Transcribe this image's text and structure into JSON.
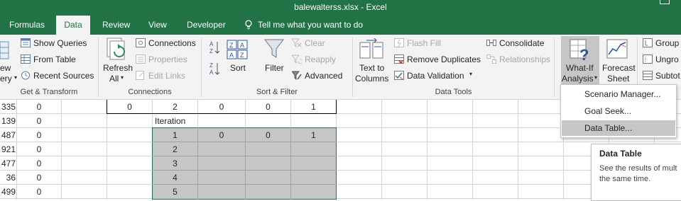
{
  "window": {
    "title": "balewalterss.xlsx - Excel"
  },
  "tabs": [
    {
      "label": "Formulas"
    },
    {
      "label": "Data"
    },
    {
      "label": "Review"
    },
    {
      "label": "View"
    },
    {
      "label": "Developer"
    }
  ],
  "tell_me": "Tell me what you want to do",
  "ribbon": {
    "get_transform": {
      "new_query_line1": "ew",
      "new_query_line2": "ery",
      "show_queries": "Show Queries",
      "from_table": "From Table",
      "recent_sources": "Recent Sources",
      "group_label": "Get & Transform"
    },
    "connections": {
      "refresh_all_line1": "Refresh",
      "refresh_all_line2": "All",
      "connections": "Connections",
      "properties": "Properties",
      "edit_links": "Edit Links",
      "group_label": "Connections"
    },
    "sort_filter": {
      "sort": "Sort",
      "filter": "Filter",
      "clear": "Clear",
      "reapply": "Reapply",
      "advanced": "Advanced",
      "group_label": "Sort & Filter"
    },
    "data_tools": {
      "text_to_columns_line1": "Text to",
      "text_to_columns_line2": "Columns",
      "flash_fill": "Flash Fill",
      "remove_duplicates": "Remove Duplicates",
      "data_validation": "Data Validation",
      "consolidate": "Consolidate",
      "relationships": "Relationships",
      "group_label": "Data Tools"
    },
    "forecast": {
      "what_if_line1": "What-If",
      "what_if_line2": "Analysis",
      "forecast_sheet_line1": "Forecast",
      "forecast_sheet_line2": "Sheet",
      "group": "Group",
      "ungroup": "Ungro",
      "subtotal": "Subtot"
    }
  },
  "grid": {
    "col_a": [
      "335",
      "139",
      "487",
      "921",
      "477",
      "36",
      "499"
    ],
    "col_b": [
      "0",
      "0",
      "0",
      "0",
      "0",
      "0",
      "0"
    ],
    "row1": {
      "c": "0",
      "d": "2",
      "e": "0",
      "f": "0",
      "g": "1"
    },
    "iteration_label": "Iteration",
    "row3": {
      "d": "1",
      "e": "0",
      "f": "0",
      "g": "1"
    },
    "iterations": [
      "2",
      "3",
      "4",
      "5"
    ]
  },
  "what_if_menu": {
    "items": [
      "Scenario Manager...",
      "Goal Seek...",
      "Data Table..."
    ],
    "highlighted_index": 2
  },
  "tooltip": {
    "title": "Data Table",
    "body_line1": "See the results of mult",
    "body_line2": "the same time."
  },
  "colors": {
    "excel_green": "#217346",
    "ribbon_bg": "#f3f3f3",
    "selection_fill": "#c6c6c6",
    "selection_border": "#217346"
  }
}
